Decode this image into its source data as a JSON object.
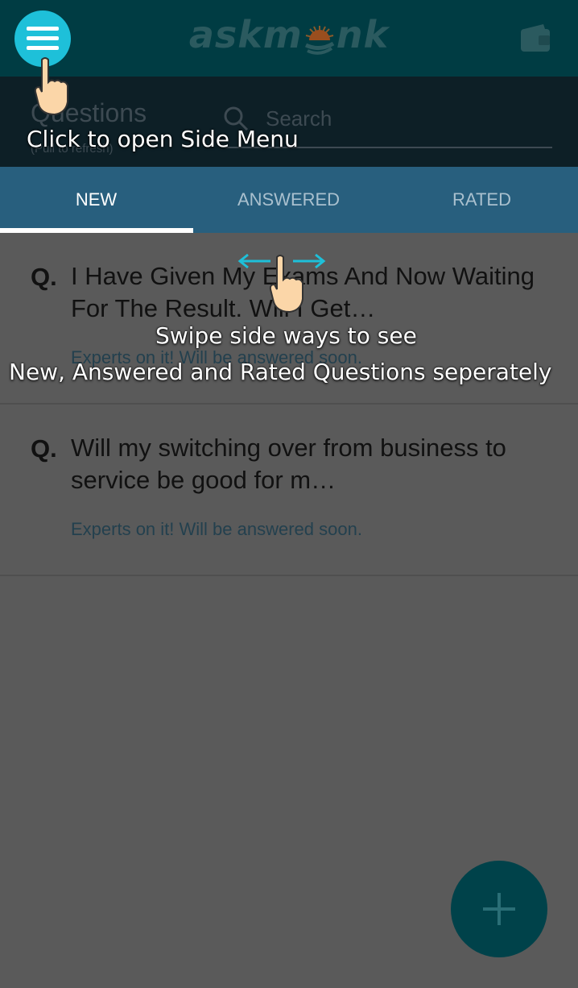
{
  "header": {
    "logo": "askmonk"
  },
  "search": {
    "title": "Questions",
    "subtitle": "(Pull to refresh)",
    "placeholder": "Search"
  },
  "tabs": [
    {
      "label": "NEW",
      "active": true
    },
    {
      "label": "ANSWERED",
      "active": false
    },
    {
      "label": "RATED",
      "active": false
    }
  ],
  "questions": [
    {
      "prefix": "Q.",
      "text": "I Have Given My Exams And Now Waiting For The Result. Will I Get…",
      "status": "Experts on it! Will be answered soon."
    },
    {
      "prefix": "Q.",
      "text": "Will my switching over from business to service be good for m…",
      "status": "Experts on it! Will be answered soon."
    }
  ],
  "tutorial": {
    "menu_hint": "Click to open Side Menu",
    "swipe_hint_line1": "Swipe side ways to see",
    "swipe_hint_line2": "New, Answered and Rated Questions seperately"
  },
  "colors": {
    "header_bg": "#003c43",
    "tab_bg": "#285f7e",
    "accent": "#1ec0d9",
    "fab": "#00424a"
  },
  "icons": [
    "hamburger-menu-icon",
    "wallet-icon",
    "search-icon",
    "plus-icon",
    "pointing-hand-icon",
    "swipe-arrows-icon"
  ]
}
